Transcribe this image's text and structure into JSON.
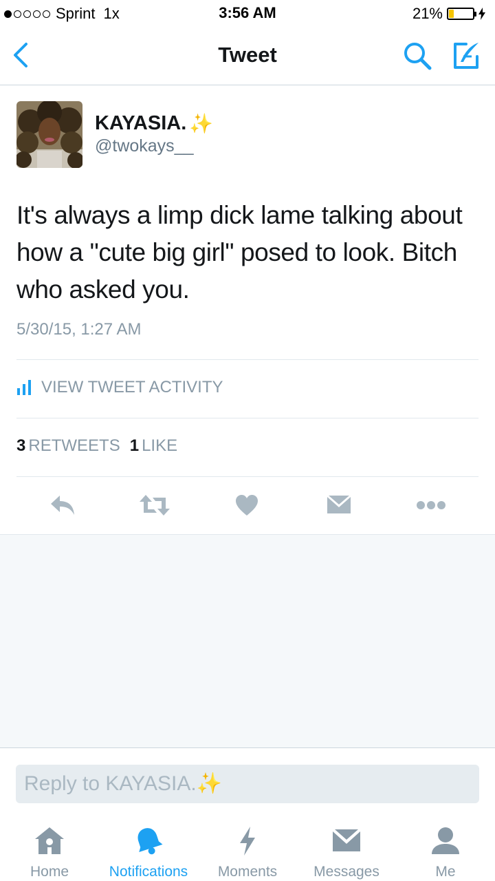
{
  "status_bar": {
    "carrier": "Sprint",
    "zoom": "1x",
    "time": "3:56 AM",
    "battery_percent": "21%",
    "battery_level": 0.21,
    "signal_bars_on": 1
  },
  "nav": {
    "title": "Tweet"
  },
  "tweet": {
    "author_name": "KAYASIA.",
    "author_sparkle": "✨",
    "handle": "@twokays__",
    "text": "It's always a limp dick lame talking about how a \"cute big girl\" posed to look. Bitch who asked you.",
    "timestamp": "5/30/15, 1:27 AM",
    "activity_label": "VIEW TWEET ACTIVITY",
    "retweet_count": "3",
    "retweet_label": "RETWEETS",
    "like_count": "1",
    "like_label": "LIKE"
  },
  "reply": {
    "placeholder": "Reply to KAYASIA.✨"
  },
  "tabs": [
    {
      "label": "Home",
      "icon": "home-icon"
    },
    {
      "label": "Notifications",
      "icon": "bell-icon"
    },
    {
      "label": "Moments",
      "icon": "lightning-icon"
    },
    {
      "label": "Messages",
      "icon": "envelope-icon"
    },
    {
      "label": "Me",
      "icon": "person-icon"
    }
  ],
  "colors": {
    "accent": "#1da1f2",
    "icon_gray": "#8899a6",
    "action_gray": "#aab8c2",
    "battery_yellow": "#f5c400"
  }
}
